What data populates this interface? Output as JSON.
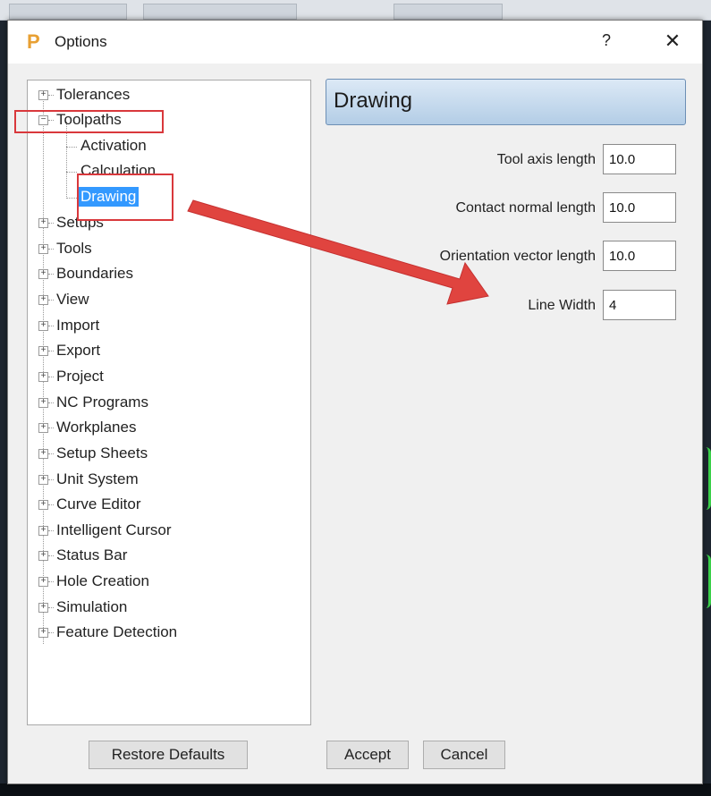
{
  "dialog": {
    "title": "Options",
    "app_icon_letter": "P",
    "help_glyph": "?",
    "close_glyph": "✕"
  },
  "tree": {
    "items": [
      {
        "label": "Tolerances",
        "expander": "+"
      },
      {
        "label": "Toolpaths",
        "expander": "−"
      },
      {
        "label": "Setups",
        "expander": "+"
      },
      {
        "label": "Tools",
        "expander": "+"
      },
      {
        "label": "Boundaries",
        "expander": "+"
      },
      {
        "label": "View",
        "expander": "+"
      },
      {
        "label": "Import",
        "expander": "+"
      },
      {
        "label": "Export",
        "expander": "+"
      },
      {
        "label": "Project",
        "expander": "+"
      },
      {
        "label": "NC Programs",
        "expander": "+"
      },
      {
        "label": "Workplanes",
        "expander": "+"
      },
      {
        "label": "Setup Sheets",
        "expander": "+"
      },
      {
        "label": "Unit System",
        "expander": "+"
      },
      {
        "label": "Curve Editor",
        "expander": "+"
      },
      {
        "label": "Intelligent Cursor",
        "expander": "+"
      },
      {
        "label": "Status Bar",
        "expander": "+"
      },
      {
        "label": "Hole Creation",
        "expander": "+"
      },
      {
        "label": "Simulation",
        "expander": "+"
      },
      {
        "label": "Feature Detection",
        "expander": "+"
      }
    ],
    "children": [
      {
        "label": "Activation"
      },
      {
        "label": "Calculation"
      },
      {
        "label": "Drawing",
        "selected": true
      }
    ]
  },
  "panel": {
    "header": "Drawing",
    "fields": [
      {
        "label": "Tool axis length",
        "value": "10.0"
      },
      {
        "label": "Contact normal length",
        "value": "10.0"
      },
      {
        "label": "Orientation vector length",
        "value": "10.0"
      },
      {
        "label": "Line Width",
        "value": "4"
      }
    ]
  },
  "buttons": {
    "restore": "Restore Defaults",
    "accept": "Accept",
    "cancel": "Cancel"
  },
  "colors": {
    "highlight": "#d9383c",
    "selection": "#3399ff",
    "header_gradient_top": "#dce9f6",
    "header_gradient_bottom": "#b3cde6"
  }
}
